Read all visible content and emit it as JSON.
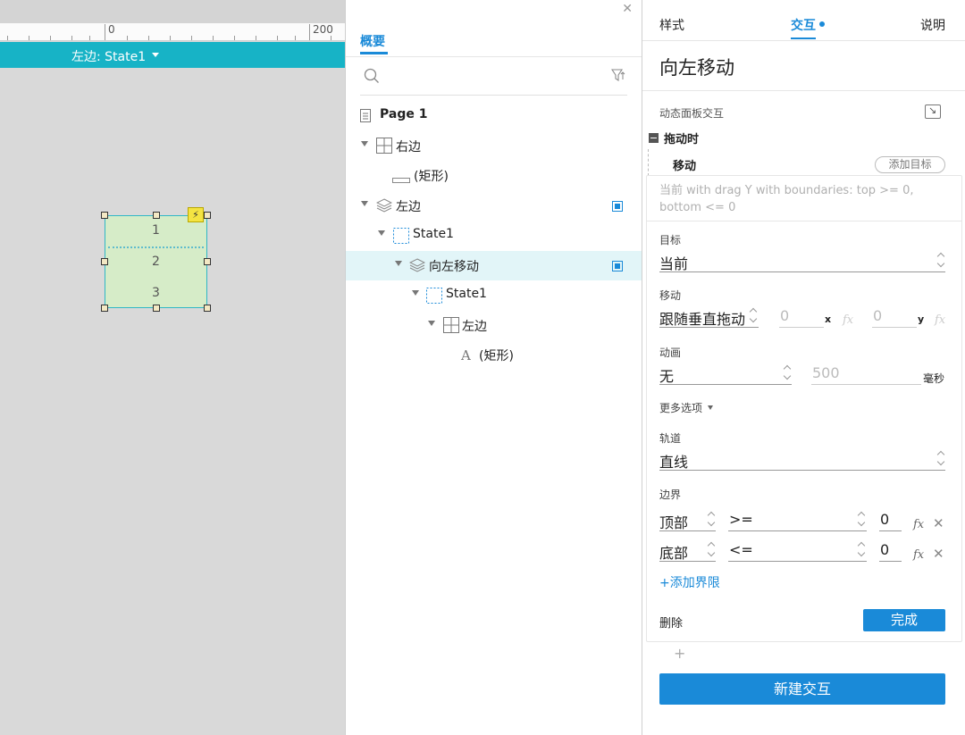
{
  "canvas": {
    "ruler_labels": [
      "0",
      "200"
    ],
    "state_label": "左边: State1",
    "widget_rows": [
      "1",
      "2",
      "3"
    ]
  },
  "outline": {
    "tab": "概要",
    "icons": {
      "search": "search-icon",
      "filter": "filter-icon",
      "close": "close-icon"
    },
    "tree": [
      {
        "label": "Page 1",
        "icon": "page-icon",
        "bold": true
      },
      {
        "label": "右边",
        "icon": "table-icon"
      },
      {
        "label": "(矩形)",
        "icon": "rectangle-icon"
      },
      {
        "label": "左边",
        "icon": "dynamic-panel-icon",
        "has_badge": true
      },
      {
        "label": "State1",
        "icon": "state-icon"
      },
      {
        "label": "向左移动",
        "icon": "dynamic-panel-icon",
        "has_badge": true,
        "selected": true
      },
      {
        "label": "State1",
        "icon": "state-icon"
      },
      {
        "label": "左边",
        "icon": "table-icon"
      },
      {
        "label": "(矩形)",
        "icon": "text-icon"
      }
    ]
  },
  "inspector": {
    "tabs": {
      "style": "样式",
      "interact": "交互",
      "notes": "说明"
    },
    "widget_title": "向左移动",
    "section_label": "动态面板交互",
    "event_label": "拖动时",
    "action_label": "移动",
    "add_target": "添加目标",
    "action_summary": "当前 with drag Y  with boundaries: top >= 0, bottom <= 0",
    "target": {
      "label": "目标",
      "value": "当前"
    },
    "move": {
      "label": "移动",
      "mode": "跟随垂直拖动",
      "x_value": "0",
      "x_suffix": "x",
      "y_value": "0",
      "y_suffix": "y"
    },
    "animation": {
      "label": "动画",
      "value": "无",
      "duration": "500",
      "unit": "毫秒"
    },
    "more_options": "更多选项",
    "track": {
      "label": "轨道",
      "value": "直线"
    },
    "bounds": {
      "label": "边界",
      "rows": [
        {
          "side": "顶部",
          "op": ">=",
          "value": "0"
        },
        {
          "side": "底部",
          "op": "<=",
          "value": "0"
        }
      ]
    },
    "add_bound": "+添加界限",
    "delete": "删除",
    "done": "完成",
    "plus": "+",
    "new_interaction": "新建交互"
  },
  "colors": {
    "accent": "#1a8ad8",
    "state_bar": "#17b3c6",
    "widget_fill": "#d6ecc8",
    "selected_row": "#e2f5f8"
  }
}
